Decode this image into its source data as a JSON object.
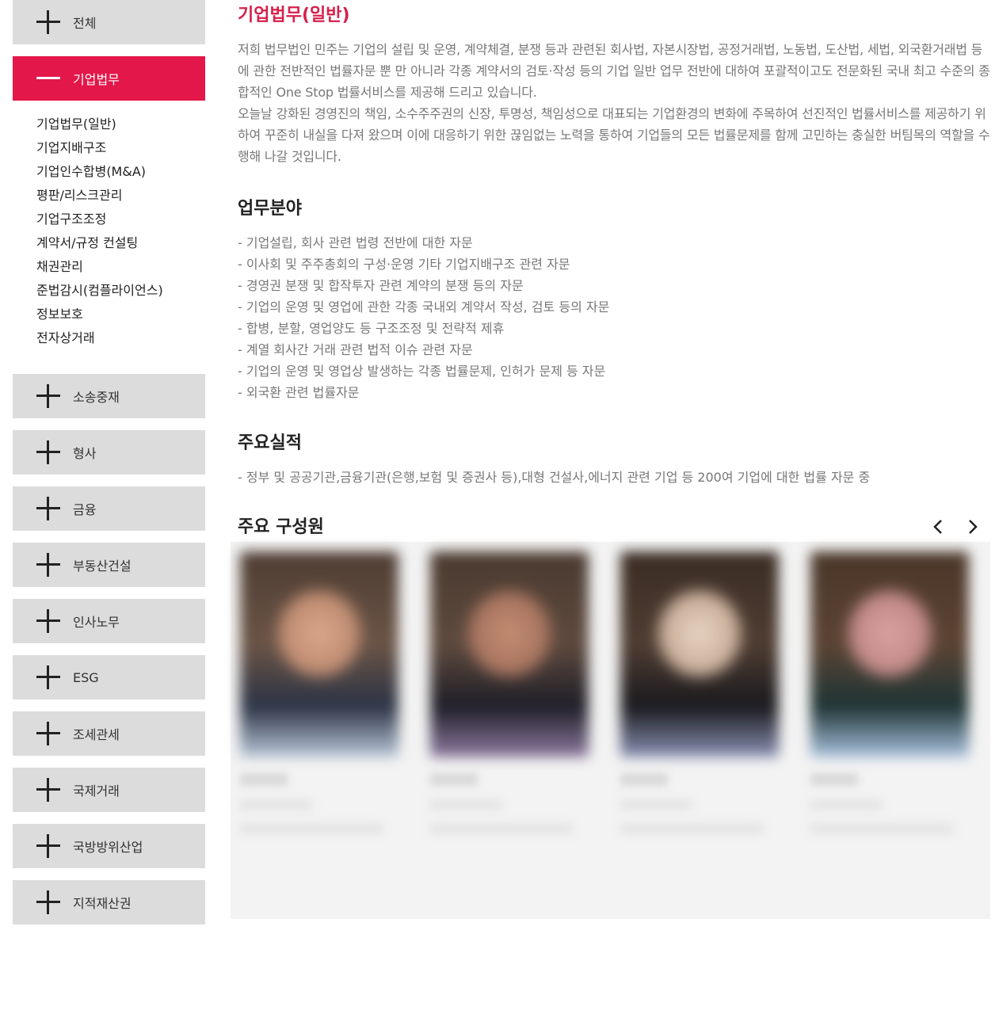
{
  "sidebar": {
    "top_item": "전체",
    "active_item": "기업법무",
    "submenu": [
      "기업법무(일반)",
      "기업지배구조",
      "기업인수합병(M&A)",
      "평판/리스크관리",
      "기업구조조정",
      "계약서/규정 컨설팅",
      "채권관리",
      "준법감시(컴플라이언스)",
      "정보보호",
      "전자상거래"
    ],
    "categories": [
      "소송중재",
      "형사",
      "금융",
      "부동산건설",
      "인사노무",
      "ESG",
      "조세관세",
      "국제거래",
      "국방방위산업",
      "지적재산권"
    ]
  },
  "main": {
    "title": "기업법무(일반)",
    "intro": [
      "저희 법무법인 민주는 기업의 설립 및 운영, 계약체결, 분쟁 등과 관련된 회사법, 자본시장법, 공정거래법, 노동법, 도산법, 세법, 외국환거래법 등에 관한 전반적인 법률자문 뿐 만 아니라 각종 계약서의 검토·작성 등의 기업 일반 업무 전반에 대하여 포괄적이고도 전문화된 국내 최고 수준의 종합적인 One Stop 법률서비스를 제공해 드리고 있습니다.",
      "오늘날 강화된 경영진의 책임, 소수주주권의 신장, 투명성, 책임성으로 대표되는 기업환경의 변화에 주목하여 선진적인 법률서비스를 제공하기 위하여 꾸준히 내실을 다져 왔으며 이에 대응하기 위한 끊임없는 노력을 통하여 기업들의 모든 법률문제를 함께 고민하는 충실한 버팀목의 역할을 수행해 나갈 것입니다."
    ],
    "areas_title": "업무분야",
    "areas": [
      "- 기업설립, 회사 관련 법령 전반에 대한 자문",
      "- 이사회 및 주주총회의 구성·운영 기타 기업지배구조 관련 자문",
      "- 경영권 분쟁 및 합작투자 관련 계약의 분쟁 등의 자문",
      "- 기업의 운영 및 영업에 관한 각종 국내외 계약서 작성, 검토 등의 자문",
      "- 합병, 분할, 영업양도 등 구조조정 및 전략적 제휴",
      "- 계열 회사간 거래 관련 법적 이슈 관련 자문",
      "- 기업의 운영 및 영업상 발생하는 각종 법률문제, 인허가 문제 등 자문",
      "- 외국환 관련 법률자문"
    ],
    "records_title": "주요실적",
    "records": [
      "- 정부 및 공공기관,금융기관(은행,보험 및 증권사 등),대형 건설사,에너지 관련 기업 등 200여 기업에 대한 법률 자문 중"
    ],
    "members_title": "주요 구성원"
  },
  "colors": {
    "accent": "#e3174a",
    "title_red": "#d6204c",
    "menu_bg": "#dcdcdc"
  },
  "icons": {
    "expand": "plus-icon",
    "collapse": "minus-icon",
    "prev": "chevron-left-icon",
    "next": "chevron-right-icon"
  }
}
